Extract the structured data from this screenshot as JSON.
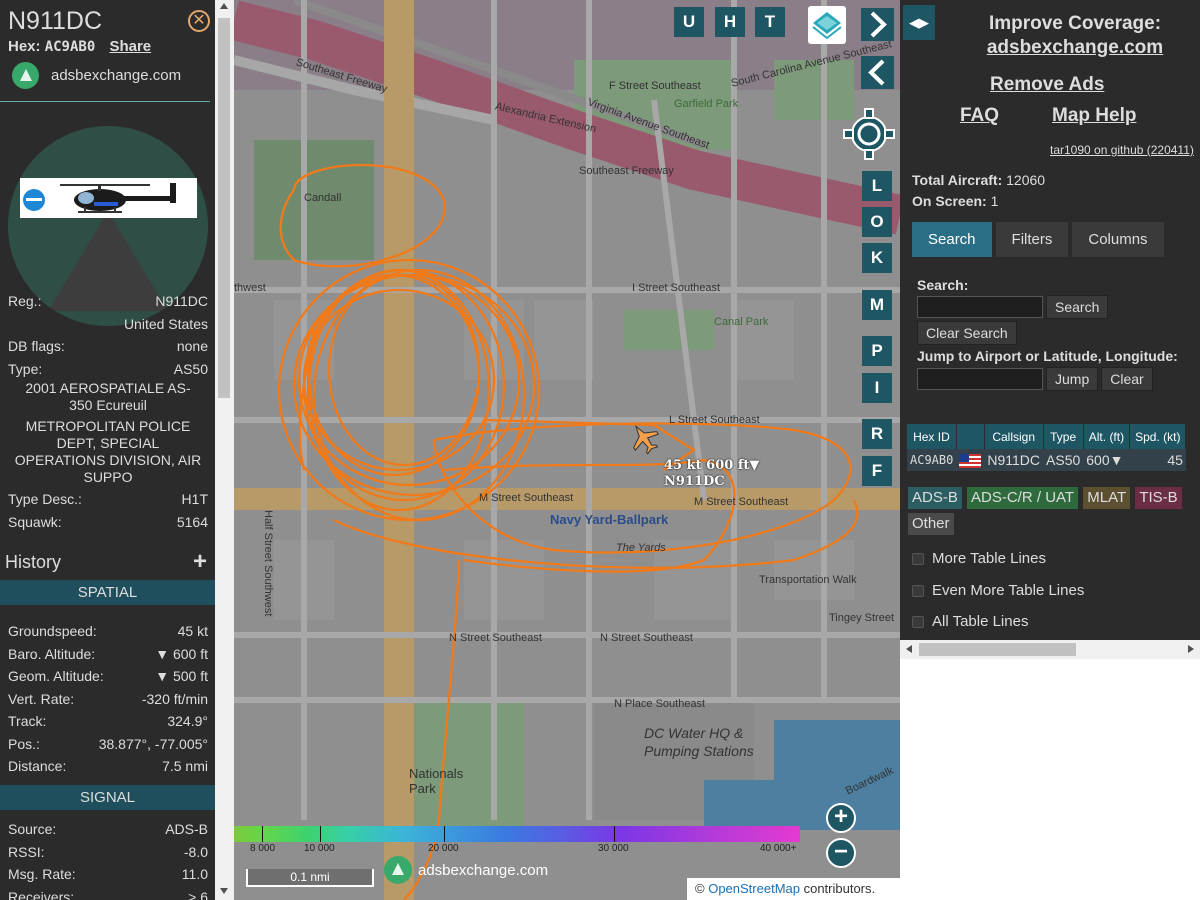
{
  "left": {
    "title": "N911DC",
    "close_glyph": "✕",
    "hex_label": "Hex:",
    "hex_value": "AC9AB0",
    "share_label": "Share",
    "site_label": "adsbexchange.com",
    "fields": {
      "reg_label": "Reg.:",
      "reg_value": "N911DC",
      "country": "United States",
      "dbflags_label": "DB flags:",
      "dbflags_value": "none",
      "type_label": "Type:",
      "type_value": "AS50",
      "model": "2001 AEROSPATIALE AS-350 Ecureuil",
      "owner": "METROPOLITAN POLICE DEPT, SPECIAL OPERATIONS DIVISION, AIR SUPPO",
      "typedesc_label": "Type Desc.:",
      "typedesc_value": "H1T",
      "squawk_label": "Squawk:",
      "squawk_value": "5164"
    },
    "history_label": "History",
    "history_plus": "+",
    "spatial_header": "SPATIAL",
    "spatial": [
      {
        "label": "Groundspeed:",
        "value": "45 kt"
      },
      {
        "label": "Baro. Altitude:",
        "value": "▼ 600 ft"
      },
      {
        "label": "Geom. Altitude:",
        "value": "▼ 500 ft"
      },
      {
        "label": "Vert. Rate:",
        "value": "-320 ft/min"
      },
      {
        "label": "Track:",
        "value": "324.9°"
      },
      {
        "label": "Pos.:",
        "value": "38.877°, -77.005°"
      },
      {
        "label": "Distance:",
        "value": "7.5 nmi"
      }
    ],
    "signal_header": "SIGNAL",
    "signal": [
      {
        "label": "Source:",
        "value": "ADS-B"
      },
      {
        "label": "RSSI:",
        "value": "-8.0"
      },
      {
        "label": "Msg. Rate:",
        "value": "11.0"
      },
      {
        "label": "Receivers:",
        "value": "> 6"
      }
    ]
  },
  "map": {
    "top_buttons": [
      "U",
      "H",
      "T"
    ],
    "side_buttons": [
      "L",
      "O",
      "K",
      "M",
      "P",
      "I",
      "R",
      "F"
    ],
    "aircraft_label_line1": "45 kt  600 ft▼",
    "aircraft_label_line2": "N911DC",
    "zoom_in": "+",
    "zoom_out": "−",
    "altitude_ticks": [
      "8 000",
      "10 000",
      "20 000",
      "30 000",
      "40 000+"
    ],
    "scale_label": "0.1 nmi",
    "watermark": "adsbexchange.com",
    "credit_prefix": "© ",
    "credit_link": "OpenStreetMap",
    "credit_suffix": " contributors.",
    "streets": {
      "southeast_freeway_top": "Southeast Freeway",
      "f_street": "F Street Southeast",
      "south_carolina": "South Carolina Avenue Southeast",
      "garfield": "Garfield Park",
      "alexandria": "Alexandria Extension",
      "virginia": "Virginia Avenue Southeast",
      "southeast_freeway": "Southeast Freeway",
      "i_street": "I Street Southeast",
      "canal_park": "Canal Park",
      "l_street": "L Street Southeast",
      "m_street_se": "M Street Southeast",
      "m_street_sw": "M Street Southeast",
      "navy_yard": "Navy Yard-Ballpark",
      "the_yards": "The Yards",
      "transport_walk": "Transportation Walk",
      "tingey": "Tingey Street",
      "n_street": "N Street Southeast",
      "n_street2": "N Street Southeast",
      "n_place": "N Place Southeast",
      "dc_water": "DC Water HQ & Pumping Stations",
      "nationals": "Nationals Park",
      "half_street": "Half Street Southwest",
      "boardwalk": "Boardwalk",
      "thwest": "thwest",
      "candall": "Candall"
    }
  },
  "right": {
    "toggle_glyph": "◀▶",
    "improve_line1": "Improve Coverage:",
    "improve_line2": "adsbexchange.com",
    "remove_ads": "Remove Ads",
    "faq": "FAQ",
    "map_help": "Map Help",
    "github": "tar1090 on github (220411)",
    "total_label": "Total Aircraft:",
    "total_value": "12060",
    "onscreen_label": "On Screen:",
    "onscreen_value": "1",
    "tabs": [
      "Search",
      "Filters",
      "Columns"
    ],
    "search_label": "Search:",
    "search_button": "Search",
    "clear_search": "Clear Search",
    "jump_label": "Jump to Airport or Latitude, Longitude:",
    "jump_button": "Jump",
    "clear_button": "Clear",
    "table_headers": [
      "Hex ID",
      "",
      "Callsign",
      "Type",
      "Alt. (ft)",
      "Spd. (kt)"
    ],
    "table_row": [
      "AC9AB0",
      "",
      "N911DC",
      "AS50",
      "600▼",
      "45"
    ],
    "badges": [
      "ADS-B",
      "ADS-C/R / UAT",
      "MLAT",
      "TIS-B",
      "Other"
    ],
    "checkboxes": [
      "More Table Lines",
      "Even More Table Lines",
      "All Table Lines"
    ]
  }
}
